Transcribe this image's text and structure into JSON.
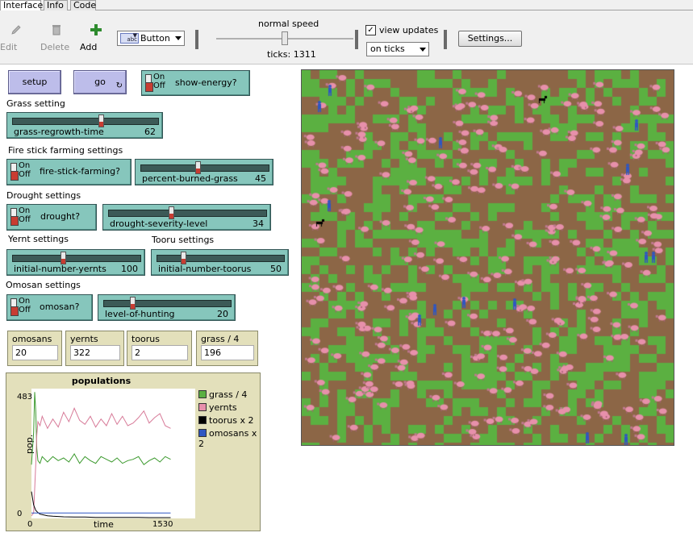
{
  "tabs": [
    {
      "label": "Interface",
      "active": true
    },
    {
      "label": "Info",
      "active": false
    },
    {
      "label": "Code",
      "active": false
    }
  ],
  "toolbar": {
    "edit_label": "Edit",
    "delete_label": "Delete",
    "add_label": "Add",
    "widget_type": "Button",
    "speed_label": "normal speed",
    "speed": 0.5,
    "ticks_label": "ticks: 1311",
    "view_updates_label": "view updates",
    "view_updates_checked": true,
    "update_mode": "on ticks",
    "settings_label": "Settings..."
  },
  "buttons": {
    "setup": "setup",
    "go": "go"
  },
  "switches": {
    "on": "On",
    "off": "Off",
    "show_energy": "show-energy?",
    "fire_stick": "fire-stick-farming?",
    "drought": "drought?",
    "omosan": "omosan?"
  },
  "labels": {
    "grass": "Grass setting",
    "fire": "Fire stick farming settings",
    "drought": "Drought settings",
    "yernt": "Yernt settings",
    "tooru": "Tooru settings",
    "omosan": "Omosan settings"
  },
  "sliders": [
    {
      "name": "grass-regrowth-time",
      "value": "62",
      "fraction": 0.62
    },
    {
      "name": "percent-burned-grass",
      "value": "45",
      "fraction": 0.45
    },
    {
      "name": "drought-severity-level",
      "value": "34",
      "fraction": 0.4
    },
    {
      "name": "initial-number-yernts",
      "value": "100",
      "fraction": 0.4
    },
    {
      "name": "initial-number-toorus",
      "value": "50",
      "fraction": 0.2
    },
    {
      "name": "level-of-hunting",
      "value": "20",
      "fraction": 0.22
    }
  ],
  "monitors": [
    {
      "name": "omosans",
      "value": "20"
    },
    {
      "name": "yernts",
      "value": "322"
    },
    {
      "name": "toorus",
      "value": "2"
    },
    {
      "name": "grass / 4",
      "value": "196"
    }
  ],
  "colors": {
    "grass": "#5bb041",
    "dirt": "#8c6646",
    "sheep": "#e790ab",
    "omosan": "#2f56c2",
    "tooru": "#000000"
  },
  "chart_data": {
    "type": "line",
    "title": "populations",
    "xlabel": "time",
    "ylabel": "pop.",
    "xlim": [
      0,
      1530
    ],
    "ylim": [
      0,
      483
    ],
    "x_ticks": [
      "0",
      "1530"
    ],
    "y_ticks": [
      "0",
      "483"
    ],
    "legend_position": "right",
    "series": [
      {
        "name": "grass / 4",
        "color": "#3c9a2e",
        "x": [
          0,
          20,
          30,
          40,
          50,
          60,
          80,
          100,
          150,
          200,
          250,
          300,
          350,
          400,
          450,
          500,
          550,
          600,
          650,
          700,
          750,
          800,
          850,
          900,
          950,
          1000,
          1050,
          1100,
          1150,
          1200,
          1250,
          1300
        ],
        "y": [
          200,
          320,
          470,
          400,
          260,
          215,
          205,
          230,
          210,
          230,
          215,
          225,
          210,
          240,
          205,
          230,
          215,
          205,
          230,
          220,
          210,
          225,
          205,
          215,
          220,
          230,
          200,
          215,
          225,
          210,
          230,
          220
        ]
      },
      {
        "name": "yernts",
        "color": "#d77a98",
        "x": [
          0,
          20,
          40,
          50,
          60,
          80,
          100,
          150,
          200,
          250,
          300,
          350,
          400,
          450,
          500,
          550,
          600,
          650,
          700,
          750,
          800,
          850,
          900,
          950,
          1000,
          1050,
          1100,
          1150,
          1200,
          1250,
          1300
        ],
        "y": [
          10,
          20,
          200,
          310,
          360,
          345,
          380,
          335,
          370,
          340,
          395,
          360,
          410,
          365,
          350,
          380,
          340,
          370,
          345,
          390,
          350,
          380,
          345,
          355,
          375,
          400,
          355,
          375,
          390,
          345,
          335
        ]
      },
      {
        "name": "toorus x 2",
        "color": "#000000",
        "x": [
          0,
          20,
          40,
          60,
          80,
          100,
          150,
          200,
          300,
          400,
          500,
          600,
          700,
          800,
          900,
          1000,
          1100,
          1200,
          1300
        ],
        "y": [
          100,
          50,
          30,
          22,
          16,
          14,
          10,
          8,
          6,
          5,
          5,
          4,
          4,
          4,
          4,
          4,
          3,
          3,
          3
        ]
      },
      {
        "name": "omosans x 2",
        "color": "#2f56c2",
        "x": [
          0,
          1300
        ],
        "y": [
          20,
          20
        ]
      }
    ]
  }
}
